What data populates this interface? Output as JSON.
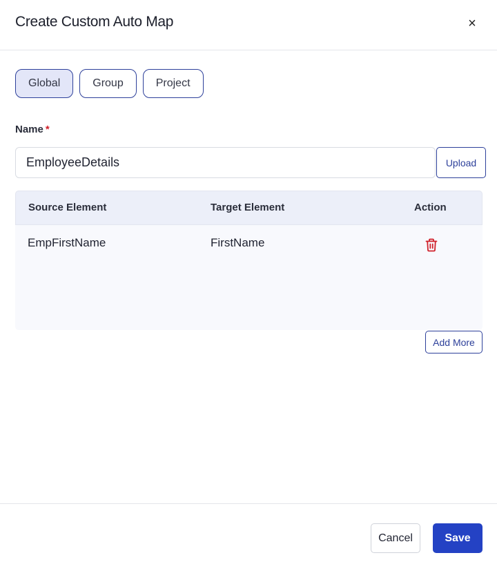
{
  "dialog": {
    "title": "Create Custom Auto Map",
    "close_label": "×"
  },
  "scope_tabs": [
    {
      "label": "Global",
      "active": true
    },
    {
      "label": "Group",
      "active": false
    },
    {
      "label": "Project",
      "active": false
    }
  ],
  "name_field": {
    "label": "Name",
    "required_marker": "*",
    "value": "EmployeeDetails"
  },
  "upload_label": "Upload",
  "mapping_table": {
    "headers": [
      "Source Element",
      "Target Element",
      "Action"
    ],
    "rows": [
      {
        "source": "EmpFirstName",
        "target": "FirstName",
        "action_icon": "trash-icon"
      }
    ]
  },
  "add_more_label": "Add More",
  "footer": {
    "cancel_label": "Cancel",
    "save_label": "Save"
  },
  "colors": {
    "accent": "#2442c4",
    "outline": "#2c3f9a",
    "delete": "#d0202a",
    "active_tab_bg": "#e3e6f8"
  }
}
